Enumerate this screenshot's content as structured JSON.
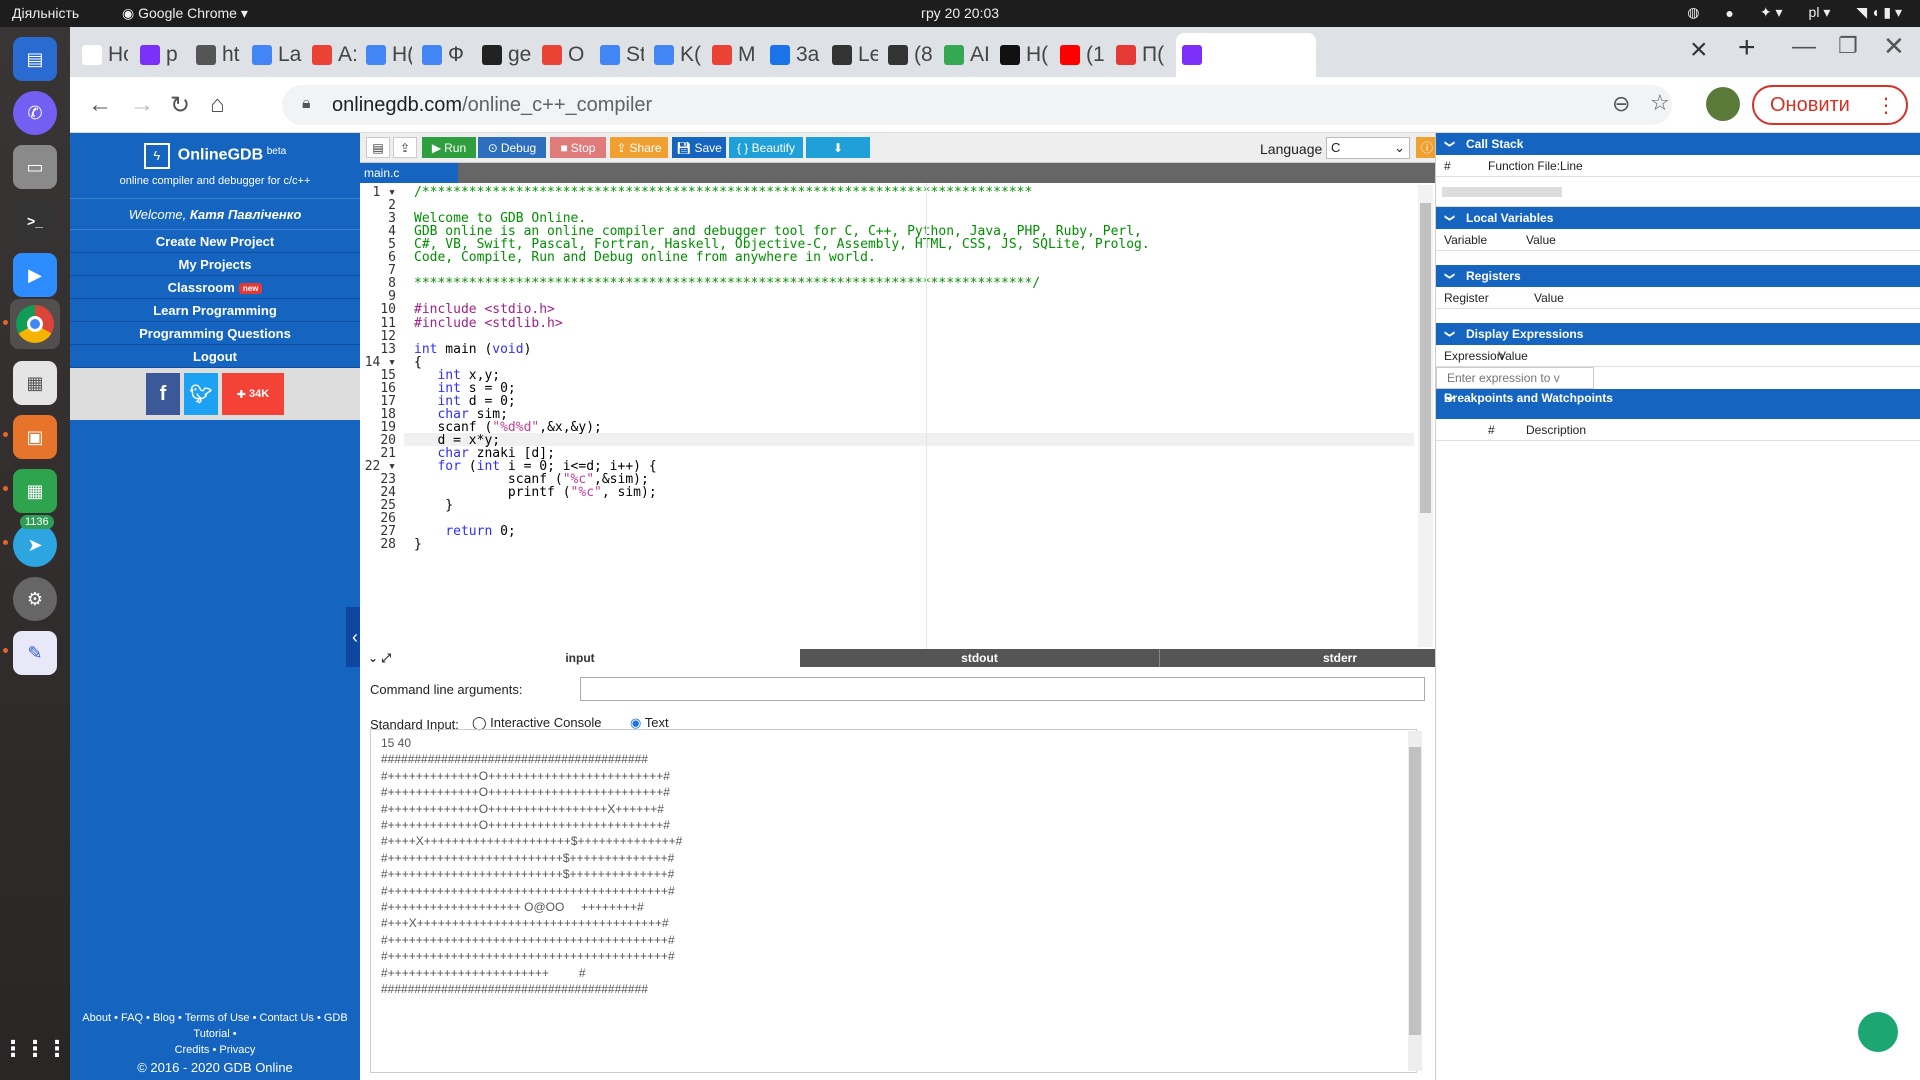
{
  "desktop": {
    "activities": "Діяльність",
    "app_menu": "Google Chrome",
    "clock": "гру 20  20:03",
    "lang": "pl",
    "telegram_badge": "1136"
  },
  "tabs": [
    {
      "label": "Нова",
      "color": "#ffffff"
    },
    {
      "label": "p",
      "color": "#7b2ff7"
    },
    {
      "label": "ht",
      "color": "#555555"
    },
    {
      "label": "La",
      "color": "#4285f4"
    },
    {
      "label": "A:",
      "color": "#ea4335"
    },
    {
      "label": "H(",
      "color": "#4285f4"
    },
    {
      "label": "Ф",
      "color": "#4285f4"
    },
    {
      "label": "ge",
      "color": "#222222"
    },
    {
      "label": "O",
      "color": "#ea4335"
    },
    {
      "label": "St",
      "color": "#4285f4"
    },
    {
      "label": "K(",
      "color": "#4285f4"
    },
    {
      "label": "M",
      "color": "#ea4335"
    },
    {
      "label": "3a",
      "color": "#1a73e8"
    },
    {
      "label": "Le",
      "color": "#333333"
    },
    {
      "label": "(8",
      "color": "#333333"
    },
    {
      "label": "AI",
      "color": "#34a853"
    },
    {
      "label": "H(",
      "color": "#111111"
    },
    {
      "label": "(1",
      "color": "#ff0000"
    },
    {
      "label": "П(",
      "color": "#e53935"
    },
    {
      "label": "",
      "color": "#7b2ff7"
    }
  ],
  "address": {
    "host": "onlinegdb.com",
    "path": "/online_c++_compiler"
  },
  "update_button": "Оновити",
  "sidebar": {
    "brand": "OnlineGDB",
    "beta": "beta",
    "tagline": "online compiler and debugger for c/c++",
    "welcome": "Welcome,",
    "user": "Катя Павліченко",
    "menu": [
      "Create New Project",
      "My Projects",
      "Classroom",
      "Learn Programming",
      "Programming Questions",
      "Logout"
    ],
    "new_badge": "new",
    "share_count": "34K",
    "footer1": "About • FAQ • Blog • Terms of Use • Contact Us • GDB Tutorial •",
    "footer2": "Credits • Privacy",
    "footer3": "© 2016 - 2020 GDB Online"
  },
  "editor_toolbar": {
    "run": "Run",
    "debug": "Debug",
    "stop": "Stop",
    "share": "Share",
    "save": "Save",
    "beautify": "{ } Beautify",
    "language_label": "Language",
    "language_value": "C"
  },
  "file_tab": "main.c",
  "code_lines": [
    "/******************************************************************************",
    "",
    "Welcome to GDB Online.",
    "GDB online is an online compiler and debugger tool for C, C++, Python, Java, PHP, Ruby, Perl,",
    "C#, VB, Swift, Pascal, Fortran, Haskell, Objective-C, Assembly, HTML, CSS, JS, SQLite, Prolog.",
    "Code, Compile, Run and Debug online from anywhere in world.",
    "",
    "*******************************************************************************/",
    "",
    "#include <stdio.h>",
    "#include <stdlib.h>",
    "",
    "int main (void)",
    "{",
    "   int x,y;",
    "   int s = 0;",
    "   int d = 0;",
    "   char sim;",
    "   scanf (\"%d%d\",&x,&y);",
    "   d = x*y;",
    "   char znaki [d];",
    "   for (int i = 0; i<=d; i++) {",
    "            scanf (\"%c\",&sim);",
    "            printf (\"%c\", sim);",
    "    }",
    "",
    "    return 0;",
    "}"
  ],
  "io_tabs": {
    "input": "input",
    "stdout": "stdout",
    "stderr": "stderr"
  },
  "io": {
    "cmd_label": "Command line arguments:",
    "stdin_label": "Standard Input:",
    "opt_console": "Interactive Console",
    "opt_text": "Text",
    "stdin_text": "15 40\n########################################\n#+++++++++++++O+++++++++++++++++++++++++#\n#+++++++++++++O+++++++++++++++++++++++++#\n#+++++++++++++O+++++++++++++++++X++++++#\n#+++++++++++++O+++++++++++++++++++++++++#\n#++++X+++++++++++++++++++++$++++++++++++++#\n#+++++++++++++++++++++++++$++++++++++++++#\n#+++++++++++++++++++++++++$++++++++++++++#\n#++++++++++++++++++++++++++++++++++++++++#\n#+++++++++++++++++++ O@OO     ++++++++#\n#+++X+++++++++++++++++++++++++++++++++++#\n#++++++++++++++++++++++++++++++++++++++++#\n#++++++++++++++++++++++++++++++++++++++++#\n#+++++++++++++++++++++++         #\n########################################"
  },
  "right_panel": {
    "call_stack": "Call Stack",
    "cs_cols": [
      "#",
      "Function File:Line"
    ],
    "locals": "Local Variables",
    "loc_cols": [
      "Variable",
      "Value"
    ],
    "registers": "Registers",
    "reg_cols": [
      "Register",
      "Value"
    ],
    "display": "Display Expressions",
    "disp_cols": [
      "Expression",
      "Value"
    ],
    "expr_placeholder": "Enter expression to v",
    "breakpoints": "Breakpoints and Watchpoints",
    "bp_cols": [
      "#",
      "Description"
    ]
  }
}
